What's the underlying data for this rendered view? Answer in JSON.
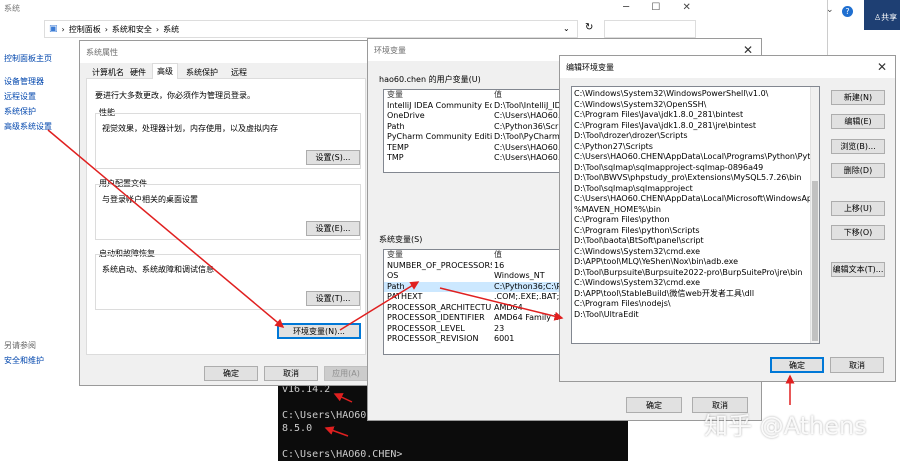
{
  "control_panel": {
    "title": "系统",
    "breadcrumb": [
      "控制面板",
      "系统和安全",
      "系统"
    ],
    "sidebar_home": "控制面板主页",
    "sidebar_items": [
      "设备管理器",
      "远程设置",
      "系统保护",
      "高级系统设置"
    ],
    "see_also": "另请参阅",
    "see_also_item": "安全和维护"
  },
  "right_strip": {
    "share": "共享"
  },
  "sysprops": {
    "title": "系统属性",
    "tabs": [
      "计算机名",
      "硬件",
      "高级",
      "系统保护",
      "远程"
    ],
    "active_tab": "高级",
    "admin_note": "要进行大多数更改，你必须作为管理员登录。",
    "perf_title": "性能",
    "perf_desc": "视觉效果，处理器计划，内存使用，以及虚拟内存",
    "perf_btn": "设置(S)...",
    "profile_title": "用户配置文件",
    "profile_desc": "与登录帐户相关的桌面设置",
    "profile_btn": "设置(E)...",
    "startup_title": "启动和故障恢复",
    "startup_desc": "系统启动、系统故障和调试信息",
    "startup_btn": "设置(T)...",
    "env_btn": "环境变量(N)...",
    "ok": "确定",
    "cancel": "取消",
    "apply": "应用(A)"
  },
  "envvars": {
    "title": "环境变量",
    "user_label": "hao60.chen 的用户变量(U)",
    "col_var": "变量",
    "col_val": "值",
    "user_vars": [
      [
        "IntelliJ IDEA Community Ed...",
        "D:\\Tool\\IntelliJ_IDE"
      ],
      [
        "OneDrive",
        "C:\\Users\\HAO60.C"
      ],
      [
        "Path",
        "C:\\Python36\\Script"
      ],
      [
        "PyCharm Community Edition",
        "D:\\Tool\\PyCharm\\"
      ],
      [
        "TEMP",
        "C:\\Users\\HAO60.C"
      ],
      [
        "TMP",
        "C:\\Users\\HAO60.C"
      ]
    ],
    "sys_label": "系统变量(S)",
    "sys_vars": [
      [
        "NUMBER_OF_PROCESSORS",
        "16"
      ],
      [
        "OS",
        "Windows_NT"
      ],
      [
        "Path",
        "C:\\Python36;C:\\Py"
      ],
      [
        "PATHEXT",
        ".COM;.EXE;.BAT;.C"
      ],
      [
        "PROCESSOR_ARCHITECTU...",
        "AMD64"
      ],
      [
        "PROCESSOR_IDENTIFIER",
        "AMD64 Family 23"
      ],
      [
        "PROCESSOR_LEVEL",
        "23"
      ],
      [
        "PROCESSOR_REVISION",
        "6001"
      ]
    ],
    "ok": "确定",
    "cancel": "取消"
  },
  "editenv": {
    "title": "编辑环境变量",
    "paths": [
      "C:\\Windows\\System32\\WindowsPowerShell\\v1.0\\",
      "C:\\Windows\\System32\\OpenSSH\\",
      "C:\\Program Files\\Java\\jdk1.8.0_281\\bintest",
      "C:\\Program Files\\Java\\jdk1.8.0_281\\jre\\bintest",
      "D:\\Tool\\drozer\\drozer\\Scripts",
      "C:\\Python27\\Scripts",
      "C:\\Users\\HAO60.CHEN\\AppData\\Local\\Programs\\Python\\Pyth...",
      "D:\\Tool\\sqlmap\\sqlmapproject-sqlmap-0896a49",
      "D:\\Tool\\BWVS\\phpstudy_pro\\Extensions\\MySQL5.7.26\\bin",
      "D:\\Tool\\sqlmap\\sqlmapproject",
      "C:\\Users\\HAO60.CHEN\\AppData\\Local\\Microsoft\\WindowsApps",
      "%MAVEN_HOME%\\bin",
      "C:\\Program Files\\python",
      "C:\\Program Files\\python\\Scripts",
      "D:\\Tool\\baota\\BtSoft\\panel\\script",
      "C:\\Windows\\System32\\cmd.exe",
      "D:\\APP\\tool\\MLQ\\YeShen\\Nox\\bin\\adb.exe",
      "D:\\Tool\\Burpsuite\\Burpsuite2022-pro\\BurpSuitePro\\jre\\bin",
      "C:\\Windows\\System32\\cmd.exe",
      "D:\\APP\\tool\\StableBuild\\微信web开发者工具\\dll",
      "C:\\Program Files\\nodejs\\",
      "D:\\Tool\\UltraEdit"
    ],
    "buttons": [
      "新建(N)",
      "编辑(E)",
      "浏览(B)...",
      "删除(D)",
      "上移(U)",
      "下移(O)",
      "编辑文本(T)..."
    ],
    "ok": "确定",
    "cancel": "取消"
  },
  "terminal": {
    "lines": [
      "v16.14.2",
      "",
      "C:\\Users\\HAO60.",
      "8.5.0",
      "",
      "C:\\Users\\HAO60.CHEN>"
    ]
  },
  "watermark": "知乎 @Athens"
}
